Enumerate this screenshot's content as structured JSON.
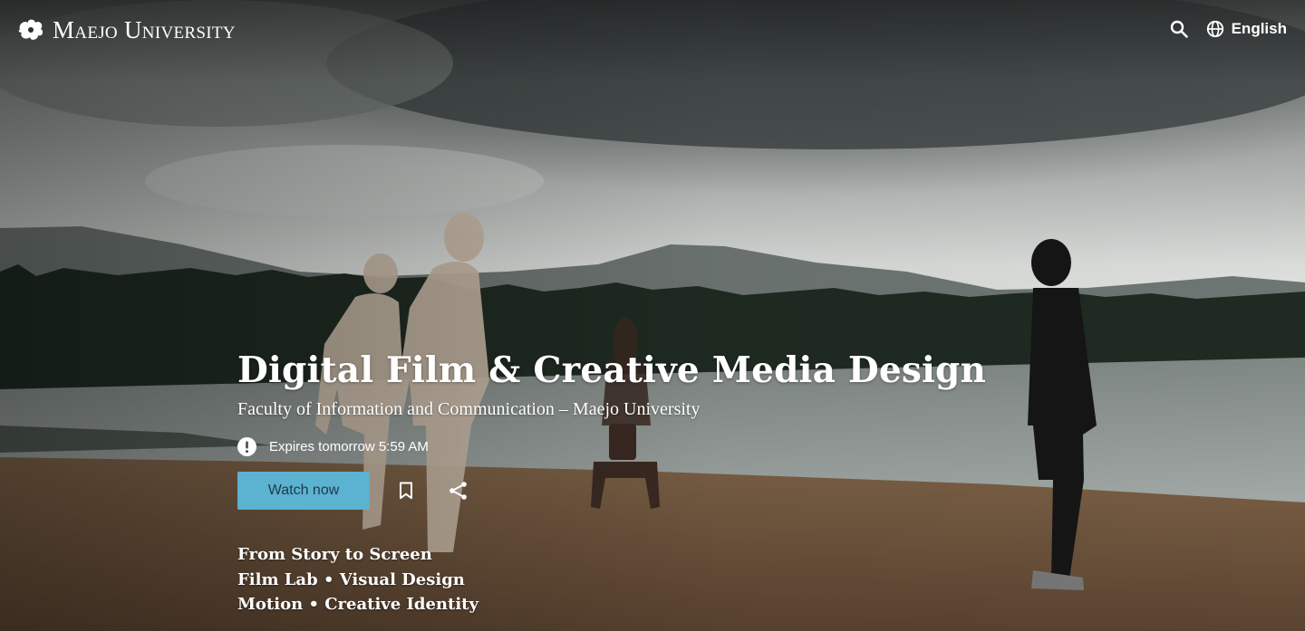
{
  "header": {
    "logo_text": "Maejo University",
    "language_label": "English"
  },
  "hero": {
    "title": "Digital Film & Creative Media Design",
    "subtitle": "Faculty of Information and Communication – Maejo University",
    "expires_text": "Expires tomorrow 5:59 AM",
    "watch_label": "Watch now",
    "tagline": [
      "From Story to Screen",
      "Film Lab • Visual Design",
      "Motion • Creative Identity"
    ]
  },
  "colors": {
    "accent": "#5cb2d1",
    "text": "#ffffff"
  },
  "icons": [
    "logo-icon",
    "search-icon",
    "globe-icon",
    "alert-icon",
    "bookmark-icon",
    "share-icon"
  ]
}
